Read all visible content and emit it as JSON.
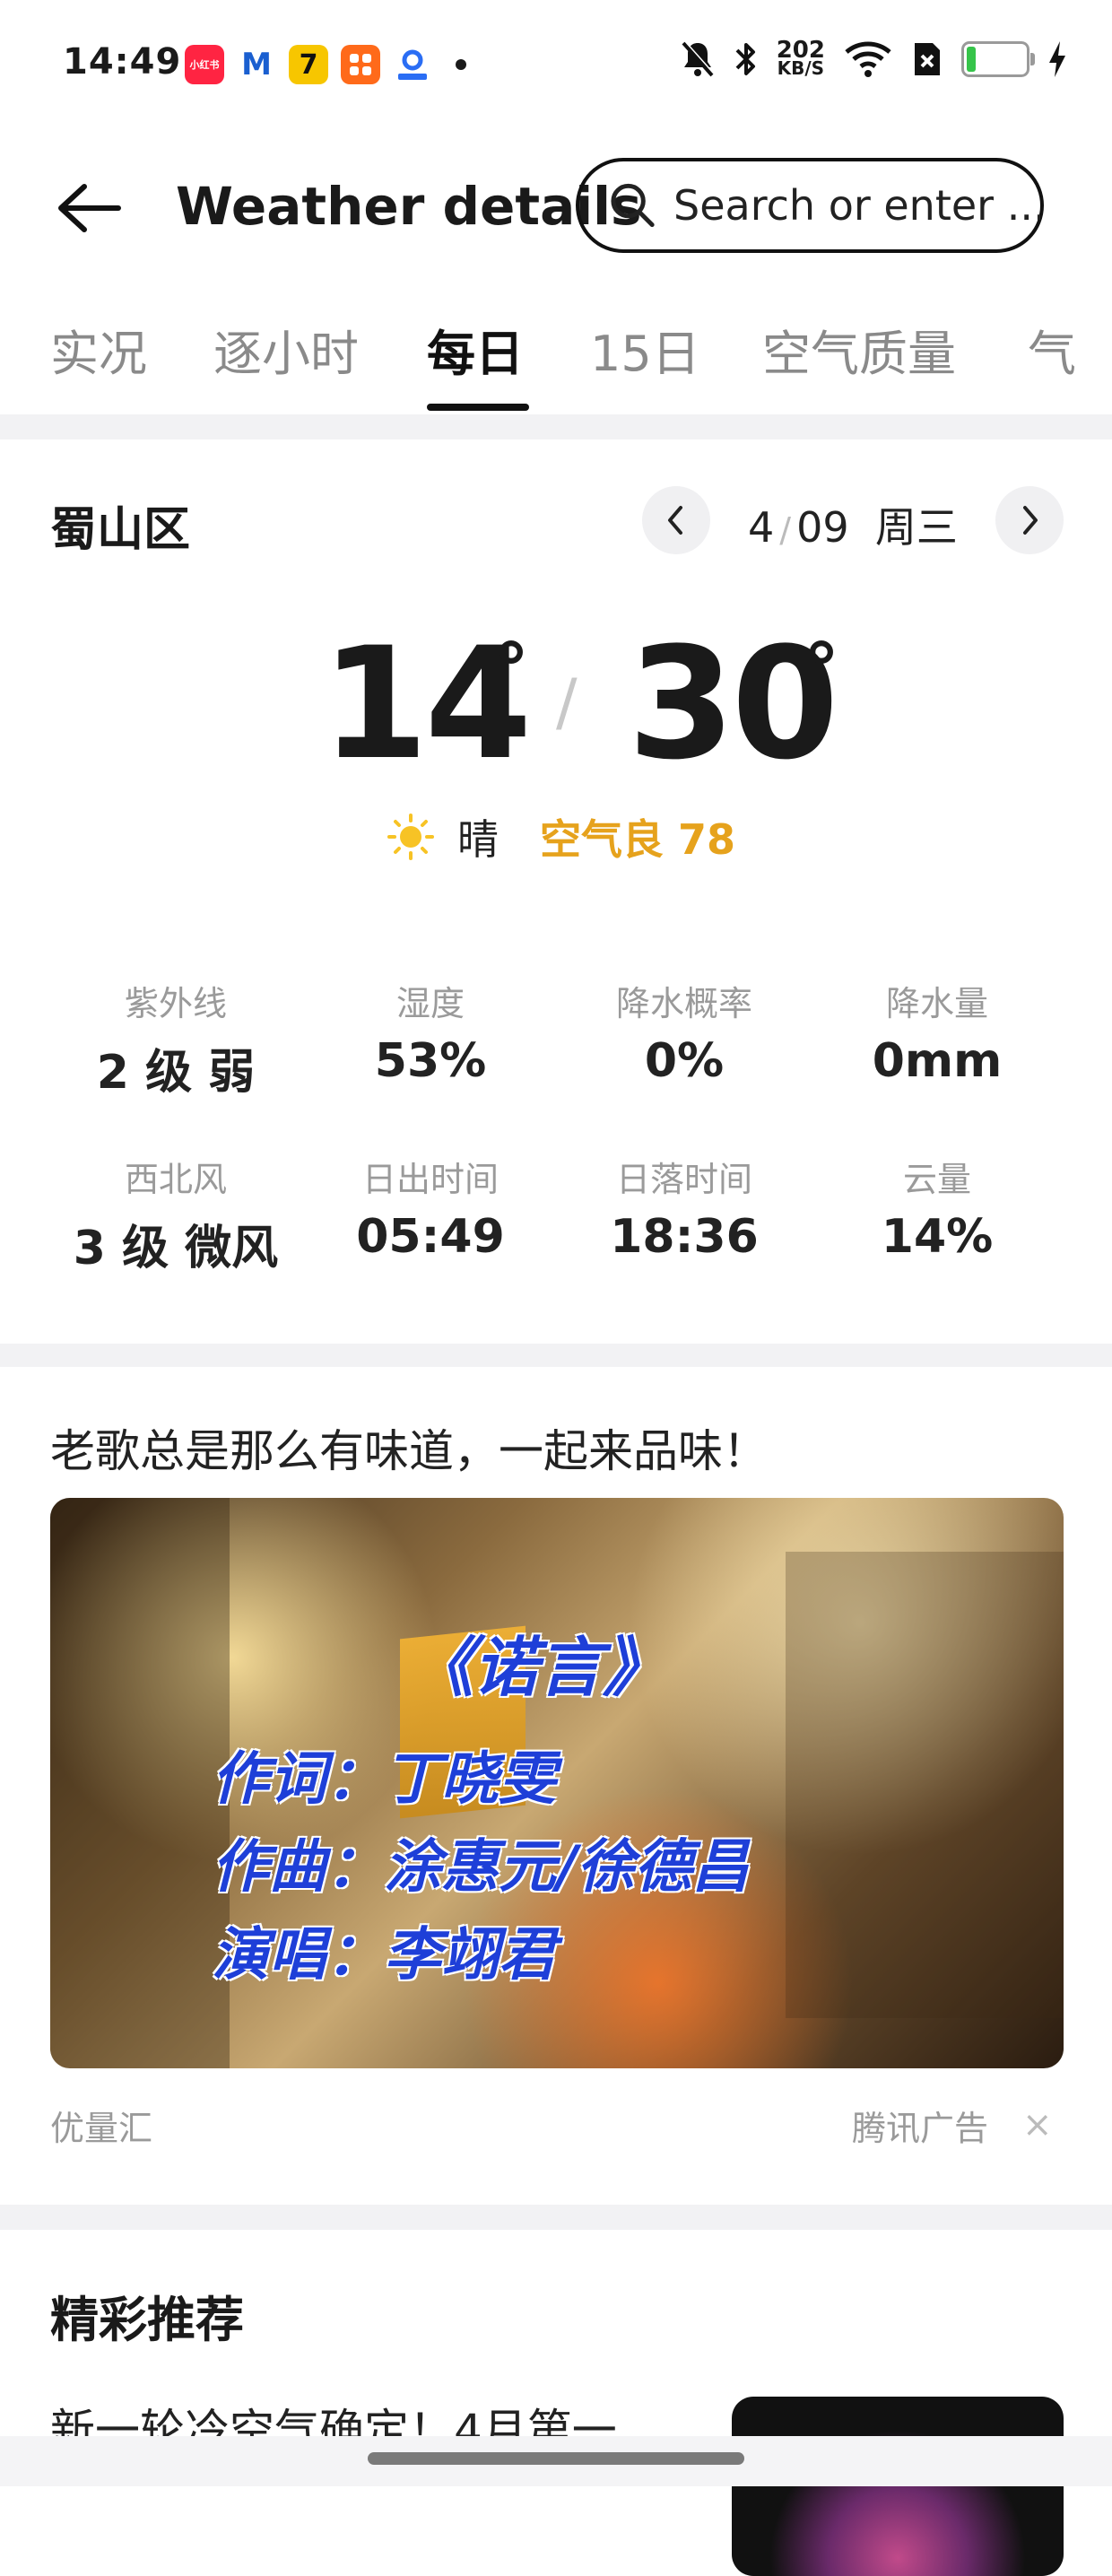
{
  "status_bar": {
    "time": "14:49",
    "app_icons": [
      {
        "name": "xiaohongshu-icon",
        "label": "小红书",
        "color": "#ff2442"
      },
      {
        "name": "m-app-icon",
        "label": "M",
        "color": "#1a5fd0"
      },
      {
        "name": "app-7-icon",
        "label": "7",
        "color": "#f7c600"
      },
      {
        "name": "grid-app-icon",
        "label": "",
        "color": "#ff6a1a"
      },
      {
        "name": "blue-app-icon",
        "label": "",
        "color": "#2a6df4"
      }
    ],
    "net_speed": "202",
    "net_unit": "KB/S",
    "battery_level": "7"
  },
  "header": {
    "title": "Weather details",
    "search_placeholder": "Search or enter ..."
  },
  "tabs": [
    {
      "label": "实况",
      "active": false
    },
    {
      "label": "逐小时",
      "active": false
    },
    {
      "label": "每日",
      "active": true
    },
    {
      "label": "15日",
      "active": false
    },
    {
      "label": "空气质量",
      "active": false
    },
    {
      "label": "气",
      "active": false
    }
  ],
  "daily": {
    "district": "蜀山区",
    "month": "4",
    "day": "09",
    "weekday": "周三",
    "low": "14",
    "high": "30",
    "degree_symbol": "°",
    "slash": "/",
    "condition": "晴",
    "air_quality": "空气良 78",
    "metrics": [
      {
        "label": "紫外线",
        "value": "2 级 弱"
      },
      {
        "label": "湿度",
        "value": "53%"
      },
      {
        "label": "降水概率",
        "value": "0%"
      },
      {
        "label": "降水量",
        "value": "0mm"
      },
      {
        "label": "西北风",
        "value": "3 级 微风"
      },
      {
        "label": "日出时间",
        "value": "05:49"
      },
      {
        "label": "日落时间",
        "value": "18:36"
      },
      {
        "label": "云量",
        "value": "14%"
      }
    ]
  },
  "ad": {
    "title": "老歌总是那么有味道，一起来品味！",
    "lyrics": {
      "song": "《诺言》",
      "lyricist": "作词：丁晓雯",
      "composer": "作曲：涂惠元/徐德昌",
      "singer": "演唱：李翊君"
    },
    "source": "优量汇",
    "provider": "腾讯广告",
    "close_symbol": "×"
  },
  "recommend": {
    "heading": "精彩推荐",
    "item_text": "新一轮冷空气确定！4月第一"
  }
}
